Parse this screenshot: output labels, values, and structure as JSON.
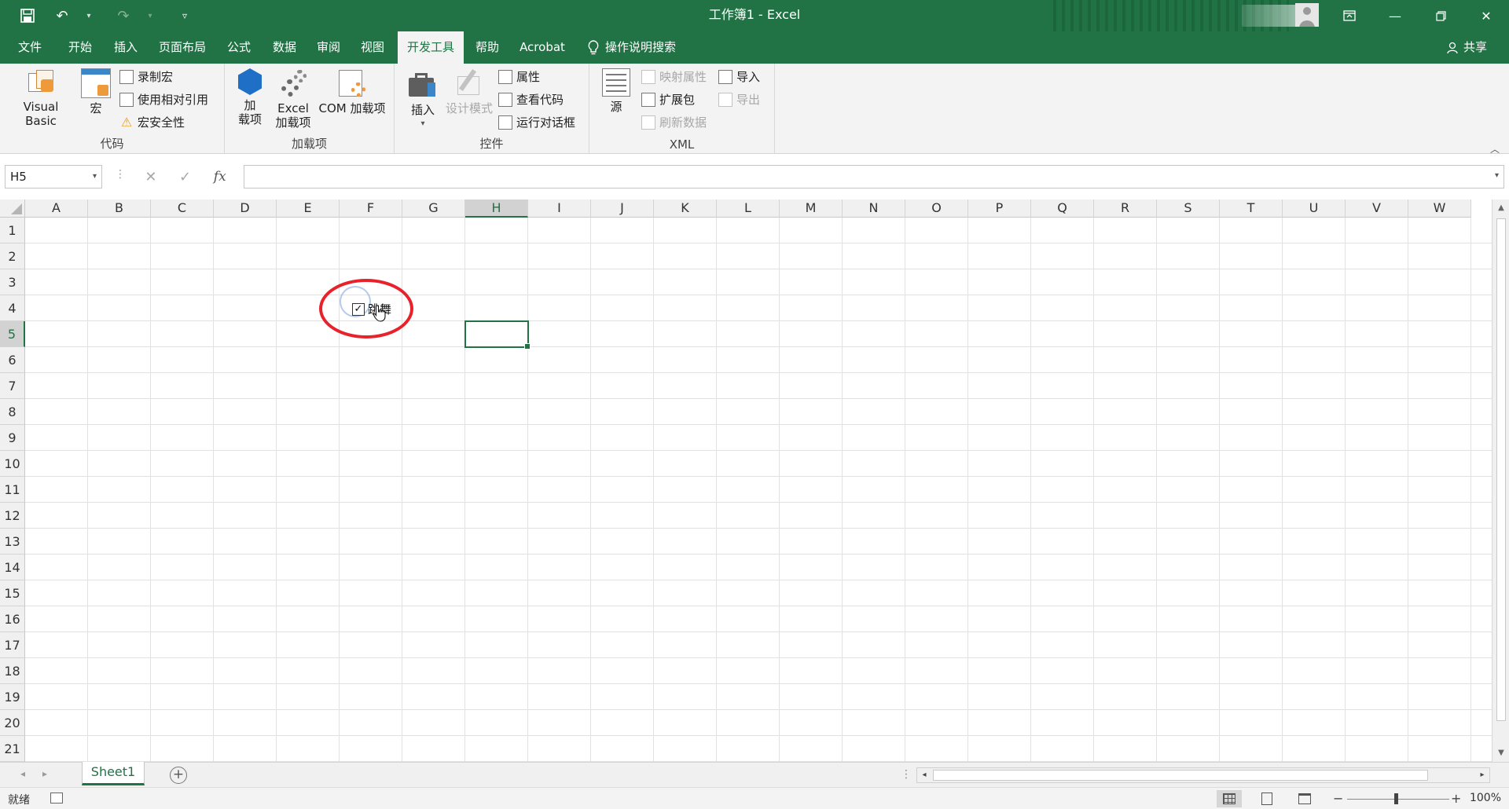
{
  "app": {
    "title": "工作簿1  -  Excel"
  },
  "quick_access": {
    "save_icon": "save-icon",
    "undo_icon": "undo-icon",
    "redo_icon": "redo-icon",
    "customize_icon": "customize-icon"
  },
  "tabs": [
    "文件",
    "开始",
    "插入",
    "页面布局",
    "公式",
    "数据",
    "审阅",
    "视图",
    "开发工具",
    "帮助",
    "Acrobat",
    "操作说明搜索"
  ],
  "active_tab": "开发工具",
  "share_label": "共享",
  "ribbon": {
    "code": {
      "label": "代码",
      "visual_basic": "Visual Basic",
      "macros": "宏",
      "record_macro": "录制宏",
      "relative_ref": "使用相对引用",
      "macro_security": "宏安全性"
    },
    "addins": {
      "label": "加载项",
      "addins_line1": "加",
      "addins_line2": "载项",
      "excel_line1": "Excel",
      "excel_line2": "加载项",
      "com": "COM 加载项"
    },
    "controls": {
      "label": "控件",
      "insert": "插入",
      "design_mode": "设计模式",
      "properties": "属性",
      "view_code": "查看代码",
      "run_dialog": "运行对话框"
    },
    "xml": {
      "label": "XML",
      "source": "源",
      "map_properties": "映射属性",
      "expansion_packs": "扩展包",
      "refresh_data": "刷新数据",
      "import": "导入",
      "export": "导出"
    }
  },
  "formula_bar": {
    "name_box": "H5",
    "fx_label": "fx",
    "formula": ""
  },
  "grid": {
    "columns": [
      "A",
      "B",
      "C",
      "D",
      "E",
      "F",
      "G",
      "H",
      "I",
      "J",
      "K",
      "L",
      "M",
      "N",
      "O",
      "P",
      "Q",
      "R",
      "S",
      "T",
      "U",
      "V",
      "W"
    ],
    "rows": [
      "1",
      "2",
      "3",
      "4",
      "5",
      "6",
      "7",
      "8",
      "9",
      "10",
      "11",
      "12",
      "13",
      "14",
      "15",
      "16",
      "17",
      "18",
      "19",
      "20",
      "21"
    ],
    "selected_column": "H",
    "selected_row": "5"
  },
  "checkbox_control": {
    "label": "跳舞",
    "checked": true
  },
  "sheets": [
    "Sheet1"
  ],
  "status": {
    "ready": "就绪",
    "zoom": "100%"
  },
  "colors": {
    "accent": "#217346",
    "highlight_circle": "#e8222a"
  }
}
